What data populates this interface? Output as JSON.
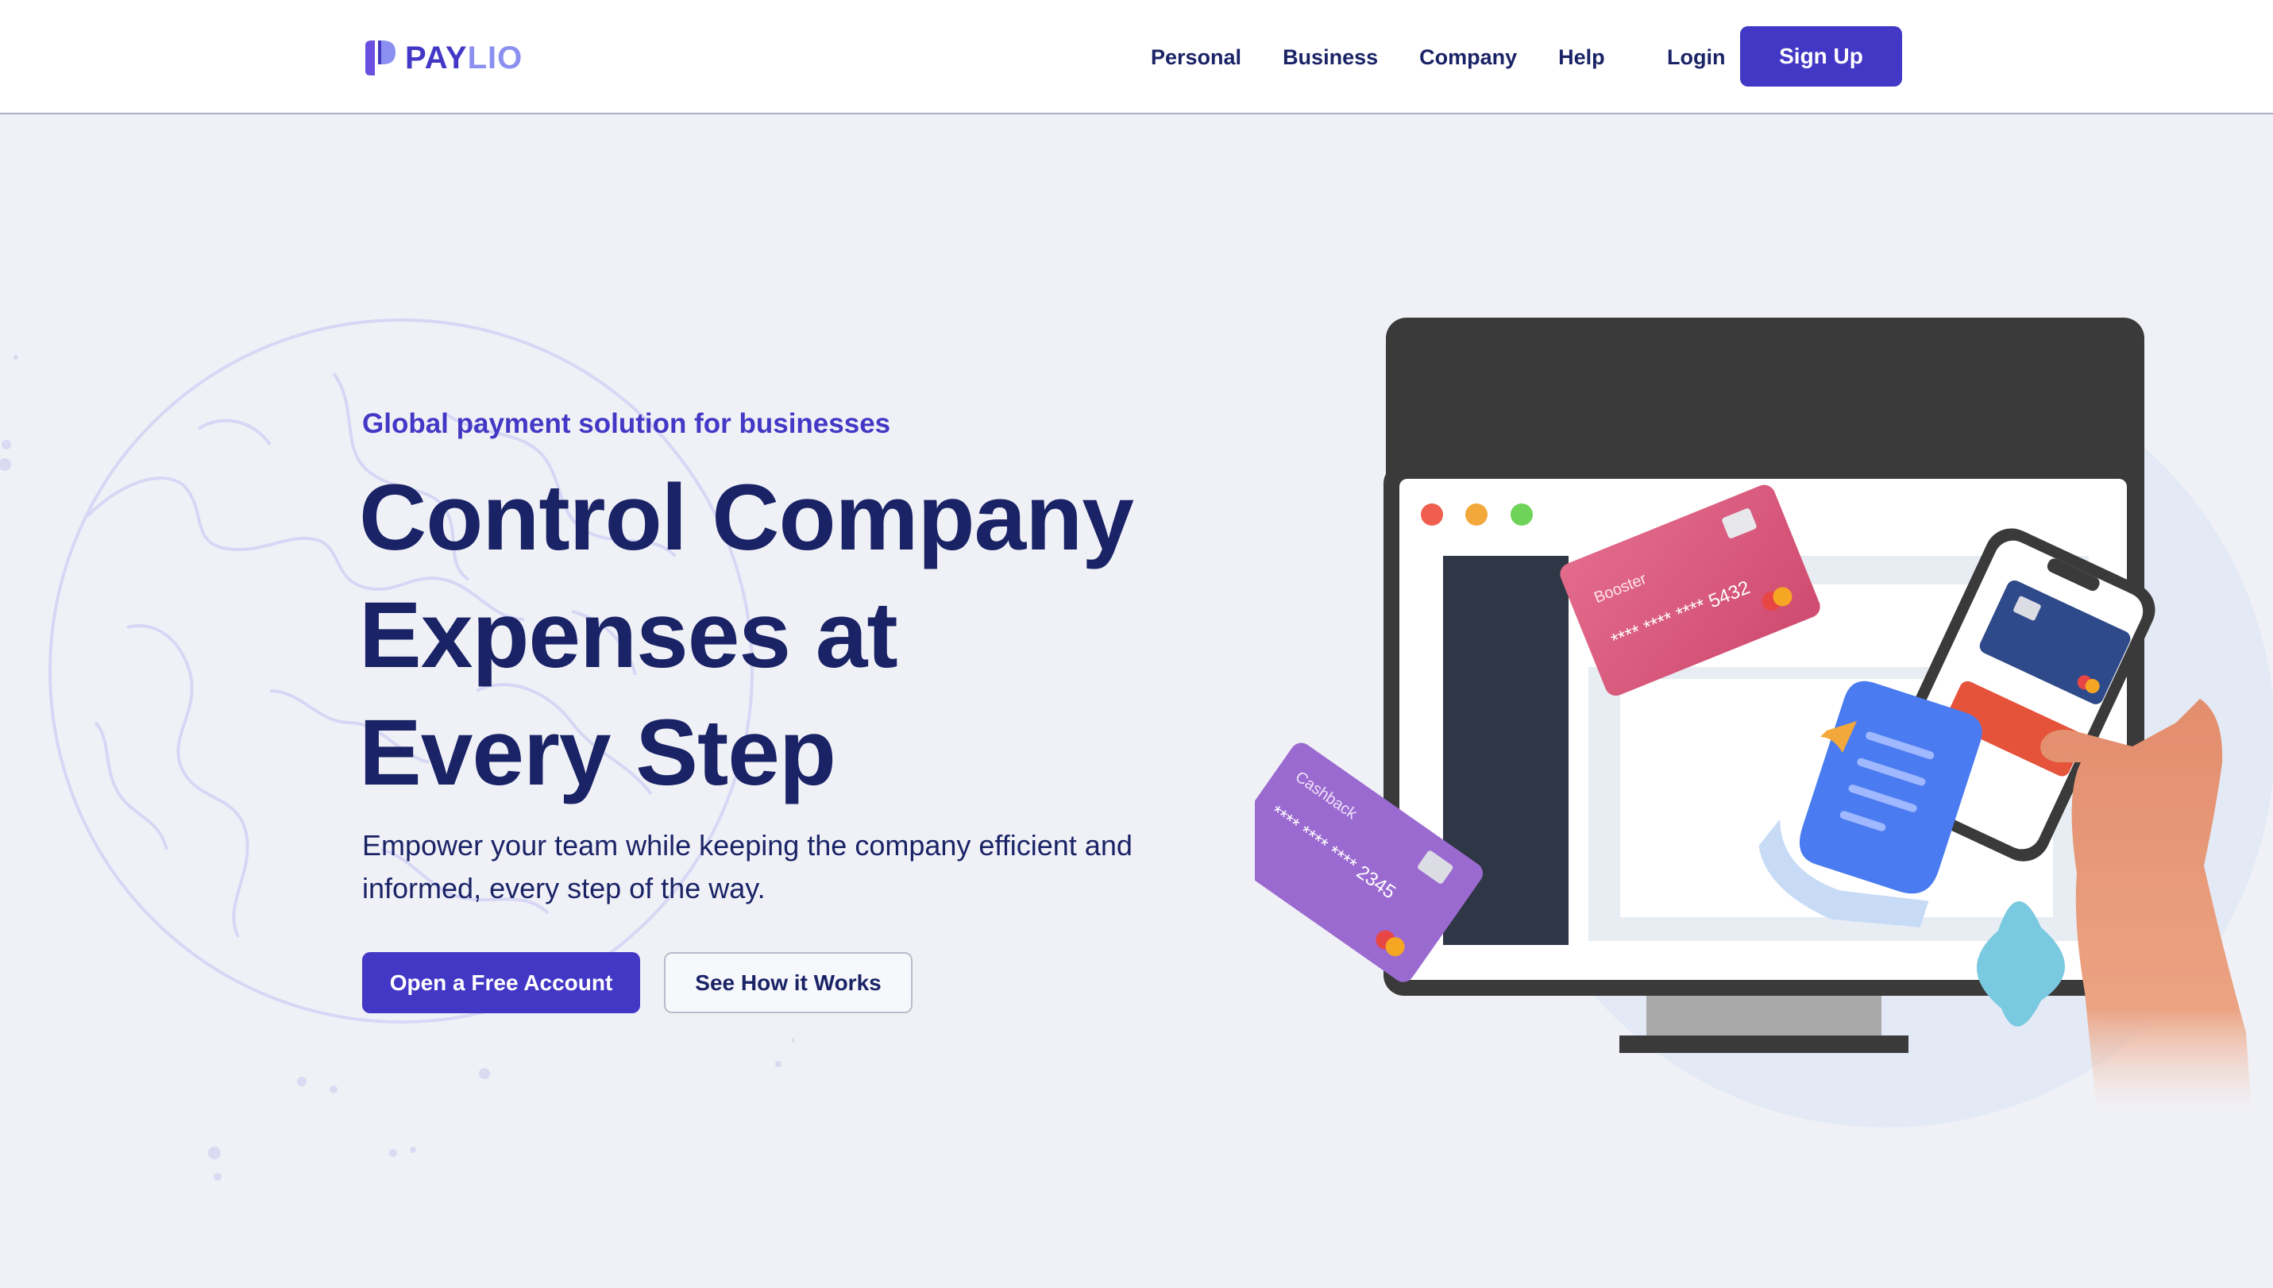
{
  "brand": {
    "name_part1": "PAY",
    "name_part2": "LIO",
    "colors": {
      "primary": "#4338c5",
      "secondary": "#8a8ff0",
      "navy": "#1a2366"
    }
  },
  "nav": {
    "items": [
      {
        "label": "Personal"
      },
      {
        "label": "Business"
      },
      {
        "label": "Company"
      },
      {
        "label": "Help"
      }
    ],
    "login_label": "Login",
    "signup_label": "Sign Up"
  },
  "hero": {
    "eyebrow": "Global payment solution for businesses",
    "headline_lines": [
      "Control Company",
      "Expenses at",
      "Every Step"
    ],
    "subtext": "Empower your team while keeping the company efficient and informed, every step of the way.",
    "primary_cta": "Open a Free Account",
    "secondary_cta": "See How it Works"
  },
  "illustration": {
    "card_pink": {
      "name": "Booster",
      "number": "**** **** **** 5432",
      "color": "#d9577a"
    },
    "card_purple": {
      "name": "Cashback",
      "number": "**** **** **** 2345",
      "color": "#9b6ad0"
    },
    "card_blue": {
      "color": "#2f4a8a"
    },
    "icons": [
      "globe-icon",
      "monitor-icon",
      "phone-icon",
      "receipt-icon",
      "hand-icon"
    ]
  }
}
